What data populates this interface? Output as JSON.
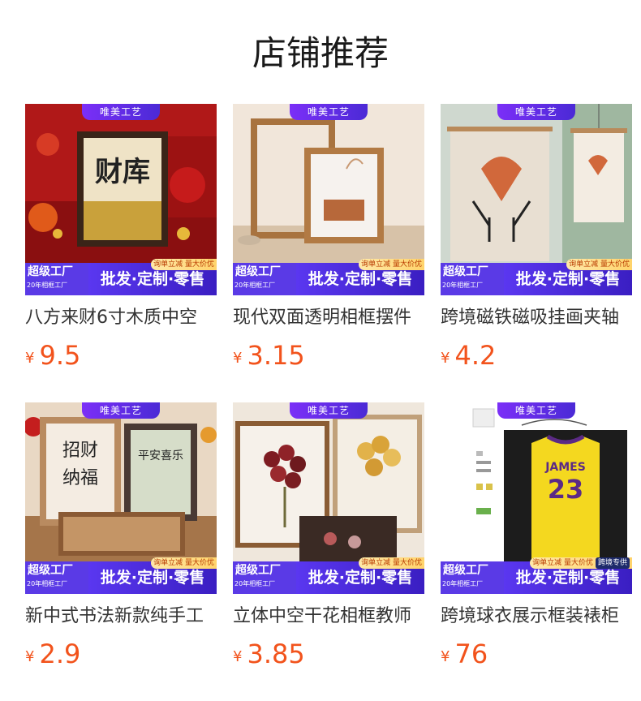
{
  "section_title": "店铺推荐",
  "badges": {
    "top_tag": "唯美工艺",
    "promo": "询单立减 量大价优",
    "factory_title": "超级工厂",
    "factory_sub": "20年相框工厂",
    "slogan": "批发·定制·零售",
    "extra_tag": "跨境专供"
  },
  "currency": "¥",
  "products": [
    {
      "name": "八方来财6寸木质中空",
      "price": "9.5"
    },
    {
      "name": "现代双面透明相框摆件",
      "price": "3.15"
    },
    {
      "name": "跨境磁铁磁吸挂画夹轴",
      "price": "4.2"
    },
    {
      "name": "新中式书法新款纯手工",
      "price": "2.9"
    },
    {
      "name": "立体中空干花相框教师",
      "price": "3.85"
    },
    {
      "name": "跨境球衣展示框装裱柜",
      "price": "76"
    }
  ],
  "colors": {
    "price": "#f2531c",
    "bar": "#3520b8",
    "tag": "#7b2ff7"
  }
}
